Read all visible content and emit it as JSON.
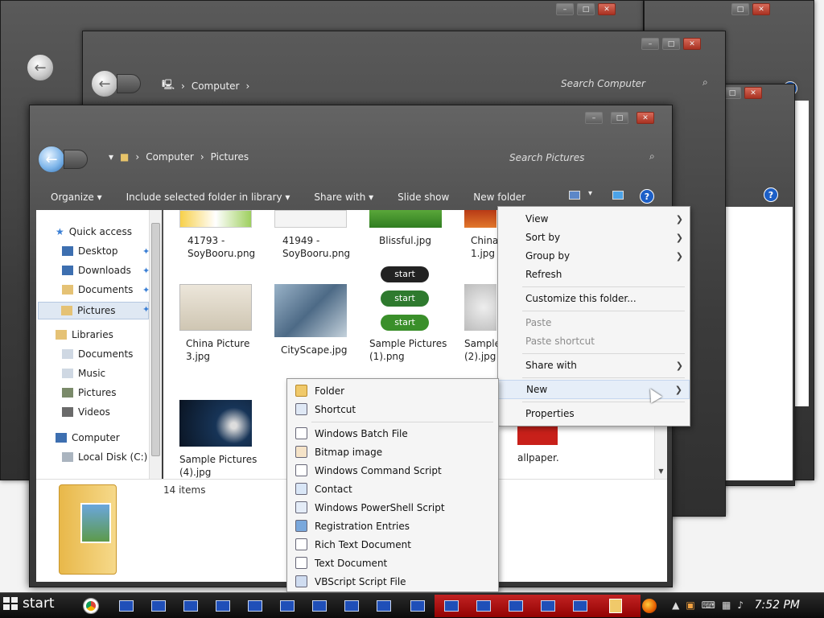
{
  "colors": {
    "accent": "#1c5fc7",
    "close": "#b53a2a",
    "taskbar": "#111111"
  },
  "back_window": {
    "crumb": "Computer",
    "search": "Search Computer"
  },
  "main_window": {
    "crumbs": [
      "Computer",
      "Pictures"
    ],
    "search": "Search Pictures",
    "toolbar": [
      "Organize ▾",
      "Include selected folder in library ▾",
      "Share with ▾",
      "Slide show",
      "New folder"
    ],
    "nav": {
      "quick_access": "Quick access",
      "desktop": "Desktop",
      "downloads": "Downloads",
      "documents": "Documents",
      "pictures": "Pictures",
      "libraries": "Libraries",
      "lib_documents": "Documents",
      "music": "Music",
      "lib_pictures": "Pictures",
      "videos": "Videos",
      "computer": "Computer",
      "local_disk": "Local Disk (C:)"
    },
    "files": {
      "f1": "41793 -\nSoyBooru.png",
      "f2": "41949 -\nSoyBooru.png",
      "f3": "Blissful.jpg",
      "f4": "China\n1.jpg",
      "f5": "China Picture\n3.jpg",
      "f6": "CityScape.jpg",
      "f7": "Sample Pictures\n(1).png",
      "f8": "Sample\n(2).jpg",
      "f9": "Sample Pictures\n(4).jpg",
      "f10": "allpaper."
    },
    "start_labels": [
      "start",
      "start",
      "start"
    ],
    "item_count": "14 items"
  },
  "context_menu": {
    "view": "View",
    "sort_by": "Sort by",
    "group_by": "Group by",
    "refresh": "Refresh",
    "customize": "Customize this folder...",
    "paste": "Paste",
    "paste_shortcut": "Paste shortcut",
    "share_with": "Share with",
    "new": "New",
    "properties": "Properties"
  },
  "new_submenu": {
    "folder": "Folder",
    "shortcut": "Shortcut",
    "batch": "Windows Batch File",
    "bitmap": "Bitmap image",
    "cmd": "Windows Command Script",
    "contact": "Contact",
    "powershell": "Windows PowerShell Script",
    "reg": "Registration Entries",
    "rtf": "Rich Text Document",
    "txt": "Text Document",
    "vbs": "VBScript Script File"
  },
  "taskbar": {
    "start": "start",
    "clock": "7:52 PM"
  }
}
